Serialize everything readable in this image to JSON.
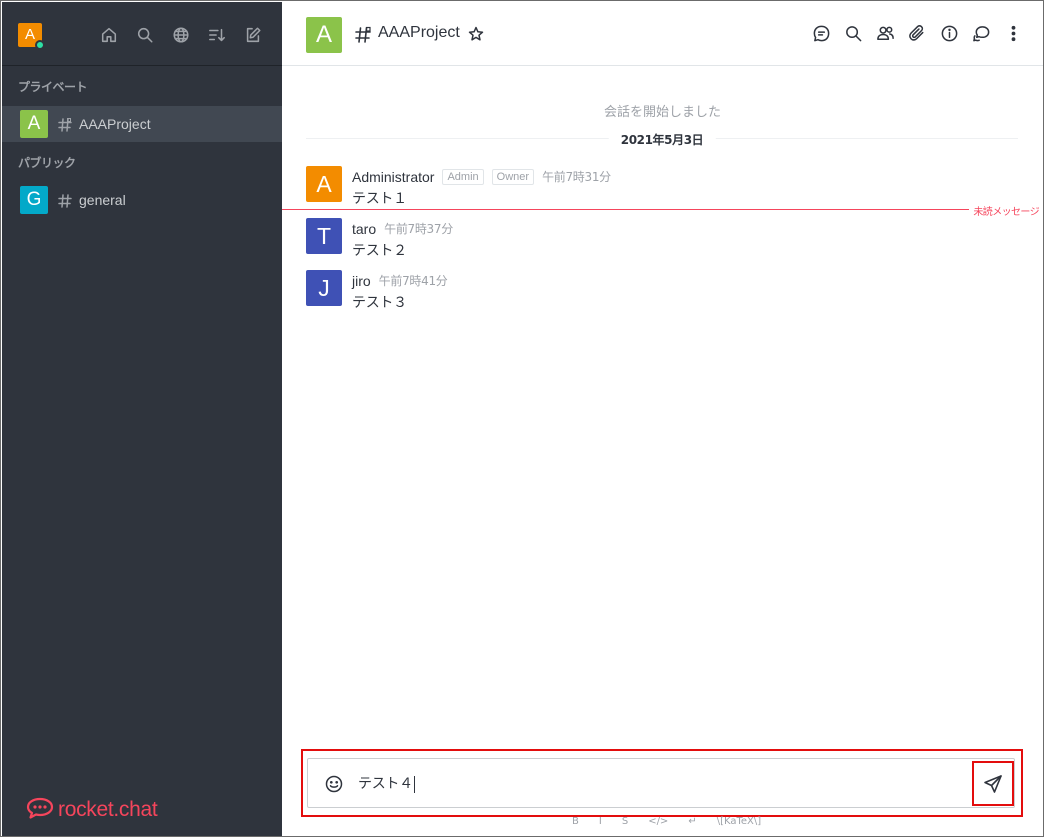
{
  "sidebar": {
    "user_avatar_letter": "A",
    "header_icons": [
      "home-icon",
      "search-icon",
      "directory-globe-icon",
      "sort-icon",
      "create-new-icon"
    ],
    "sections": {
      "private_title": "プライベート",
      "public_title": "パブリック"
    },
    "rooms": [
      {
        "avatar_letter": "A",
        "avatar_color": "#8bc34a",
        "name": "AAAProject",
        "type": "private",
        "active": true
      },
      {
        "avatar_letter": "G",
        "avatar_color": "#03a9c9",
        "name": "general",
        "type": "public",
        "active": false
      }
    ],
    "brand": "rocket.chat",
    "brand_color": "#f5455c"
  },
  "room_header": {
    "avatar_letter": "A",
    "avatar_color": "#8bc34a",
    "title": "AAAProject",
    "tools": [
      "discussion-icon",
      "search-icon",
      "members-icon",
      "attachment-icon",
      "info-icon",
      "threads-icon",
      "kebab-menu-icon"
    ]
  },
  "conversation": {
    "start_text": "会話を開始しました",
    "date": "2021年5月3日",
    "unread_label": "未読メッセージ",
    "messages": [
      {
        "avatar_letter": "A",
        "avatar_color": "#f38c00",
        "user": "Administrator",
        "roles": [
          "Admin",
          "Owner"
        ],
        "time": "午前7時31分",
        "text": "テスト１"
      },
      {
        "avatar_letter": "T",
        "avatar_color": "#3f51b5",
        "user": "taro",
        "roles": [],
        "time": "午前7時37分",
        "text": "テスト２"
      },
      {
        "avatar_letter": "J",
        "avatar_color": "#3f51b5",
        "user": "jiro",
        "roles": [],
        "time": "午前7時41分",
        "text": "テスト３"
      }
    ]
  },
  "composer": {
    "value": "テスト４",
    "toolbar": [
      "B",
      "I",
      "S",
      "</>",
      "↵",
      "\\[KaTeX\\]"
    ]
  }
}
